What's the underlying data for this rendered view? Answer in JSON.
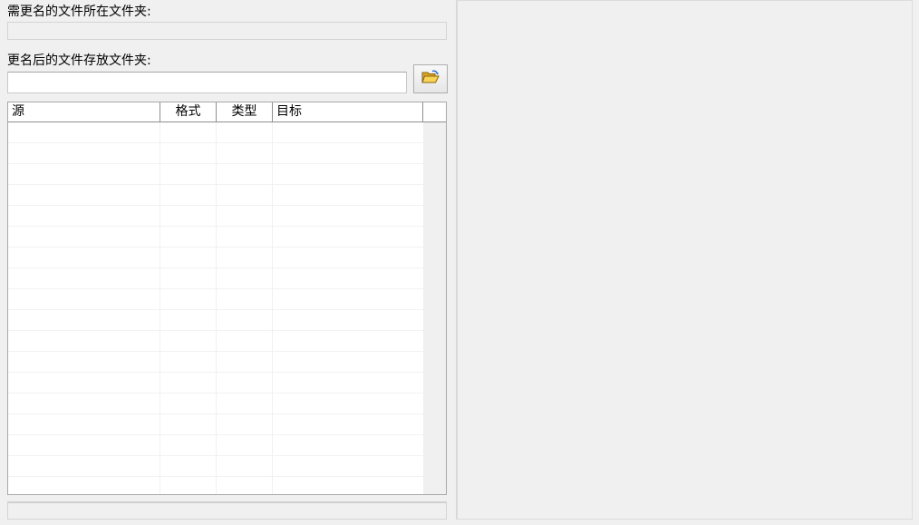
{
  "source_folder": {
    "label": "需更名的文件所在文件夹:",
    "value": ""
  },
  "target_folder": {
    "label": "更名后的文件存放文件夹:",
    "value": "",
    "browse_icon": "open-folder-icon"
  },
  "file_list": {
    "columns": [
      "源",
      "格式",
      "类型",
      "目标"
    ],
    "rows": []
  },
  "status_bar": {
    "text": ""
  }
}
